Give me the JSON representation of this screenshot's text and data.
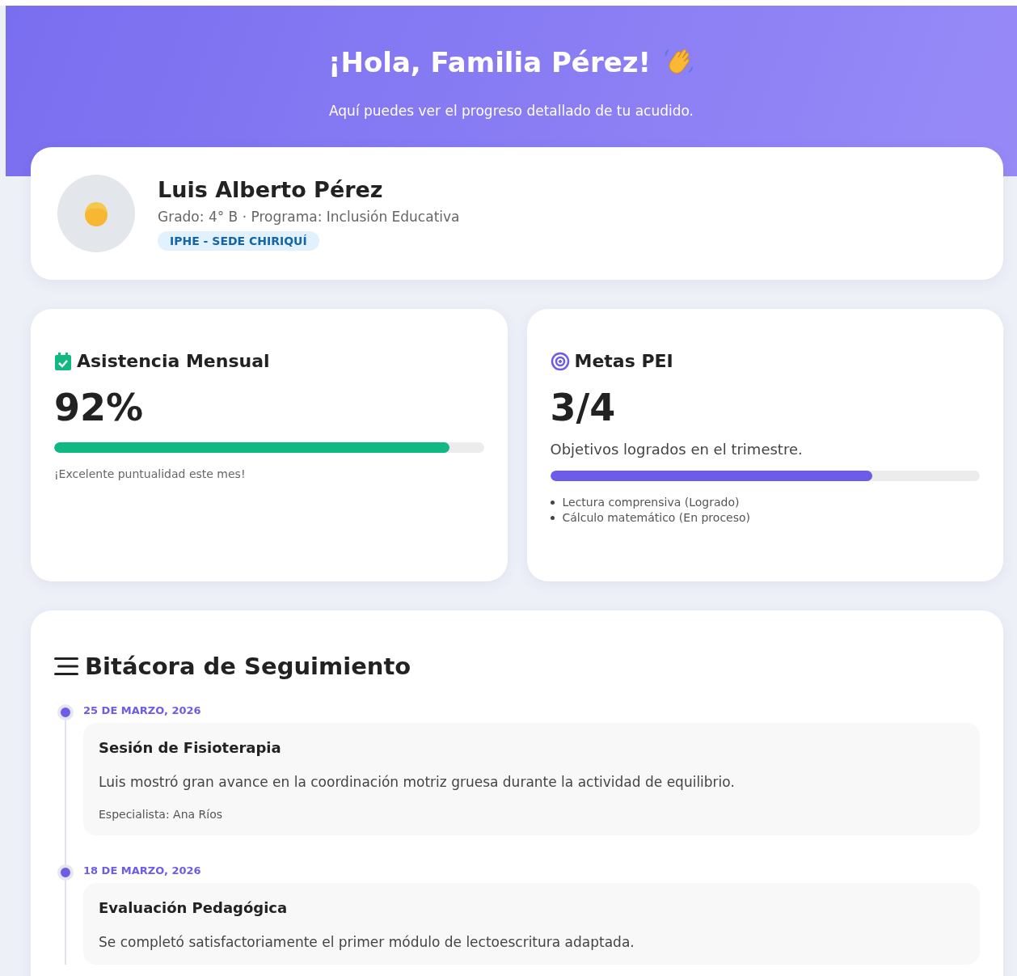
{
  "header": {
    "title": "¡Hola, Familia Pérez!",
    "subtitle": "Aquí puedes ver el progreso detallado de tu acudido."
  },
  "profile": {
    "name": "Luis Alberto Pérez",
    "details": "Grado: 4° B · Programa: Inclusión Educativa",
    "badge": "IPHE - SEDE CHIRIQUÍ"
  },
  "attendance": {
    "title": "Asistencia Mensual",
    "value": "92%",
    "level": 0.92,
    "note": "¡Excelente puntualidad este mes!"
  },
  "goals": {
    "title": "Metas PEI",
    "value": "3/4",
    "description": "Objetivos logrados en el trimestre.",
    "level": 0.75,
    "items": [
      "Lectura comprensiva (Logrado)",
      "Cálculo matemático (En proceso)"
    ]
  },
  "log": {
    "title": "Bitácora de Seguimiento",
    "entries": [
      {
        "date": "25 DE MARZO, 2026",
        "title": "Sesión de Fisioterapia",
        "text": "Luis mostró gran avance en la coordinación motriz gruesa durante la actividad de equilibrio.",
        "specialist": "Especialista: Ana Ríos"
      },
      {
        "date": "18 DE MARZO, 2026",
        "title": "Evaluación Pedagógica",
        "text": "Se completó satisfactoriamente el primer módulo de lectoescritura adaptada."
      }
    ]
  }
}
